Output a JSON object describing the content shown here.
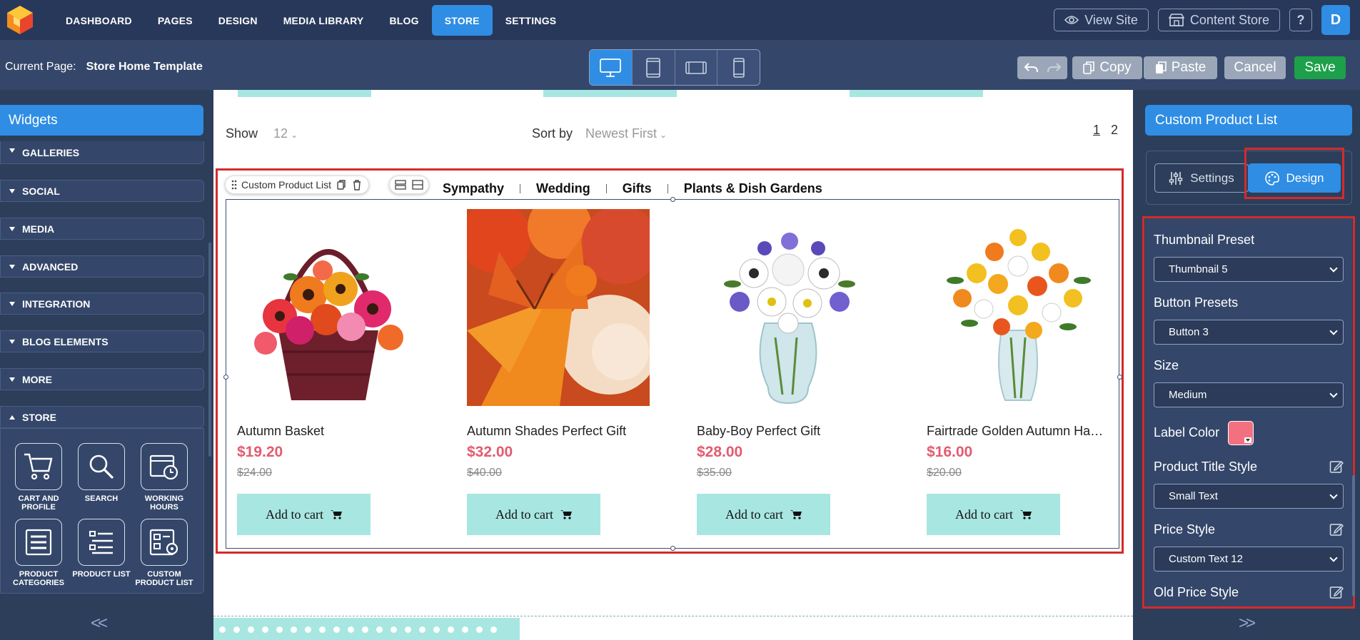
{
  "nav": {
    "items": [
      "DASHBOARD",
      "PAGES",
      "DESIGN",
      "MEDIA LIBRARY",
      "BLOG",
      "STORE",
      "SETTINGS"
    ],
    "active": "STORE",
    "view_site": "View Site",
    "content_store": "Content Store",
    "help": "?",
    "user_initial": "D"
  },
  "toolbar": {
    "current_page_label": "Current Page:",
    "current_page_value": "Store Home Template",
    "copy": "Copy",
    "paste": "Paste",
    "cancel": "Cancel",
    "save": "Save"
  },
  "left_panel": {
    "title": "Widgets",
    "categories": [
      "GALLERIES",
      "SOCIAL",
      "MEDIA",
      "ADVANCED",
      "INTEGRATION",
      "BLOG ELEMENTS",
      "MORE",
      "STORE"
    ],
    "store_widgets": [
      "CART AND PROFILE",
      "SEARCH",
      "WORKING HOURS",
      "PRODUCT CATEGORIES",
      "PRODUCT LIST",
      "CUSTOM PRODUCT LIST"
    ],
    "collapse": "<<"
  },
  "canvas": {
    "show_label": "Show",
    "show_value": "12",
    "sort_label": "Sort by",
    "sort_value": "Newest First",
    "pages": [
      "1",
      "2"
    ],
    "widget_toolbar_label": "Custom Product List",
    "category_tabs": [
      "Sympathy",
      "Wedding",
      "Gifts",
      "Plants & Dish Gardens"
    ],
    "products": [
      {
        "title": "Autumn Basket",
        "price": "$19.20",
        "old_price": "$24.00",
        "button": "Add to cart"
      },
      {
        "title": "Autumn Shades Perfect Gift",
        "price": "$32.00",
        "old_price": "$40.00",
        "button": "Add to cart"
      },
      {
        "title": "Baby-Boy Perfect Gift",
        "price": "$28.00",
        "old_price": "$35.00",
        "button": "Add to cart"
      },
      {
        "title": "Fairtrade Golden Autumn Hand...",
        "price": "$16.00",
        "old_price": "$20.00",
        "button": "Add to cart"
      }
    ]
  },
  "right_panel": {
    "title": "Custom Product List",
    "tab_settings": "Settings",
    "tab_design": "Design",
    "thumbnail_label": "Thumbnail Preset",
    "thumbnail_value": "Thumbnail 5",
    "button_label": "Button Presets",
    "button_value": "Button 3",
    "size_label": "Size",
    "size_value": "Medium",
    "label_color_label": "Label Color",
    "label_color_value": "#f27080",
    "title_style_label": "Product Title Style",
    "title_style_value": "Small Text",
    "price_style_label": "Price Style",
    "price_style_value": "Custom Text 12",
    "old_price_label": "Old Price Style",
    "collapse": ">>"
  },
  "colors": {
    "accent": "#2f8de4",
    "save": "#1da04a",
    "price": "#e35b70",
    "selection": "#d42b2b",
    "cart_button": "#a8e6e2"
  }
}
